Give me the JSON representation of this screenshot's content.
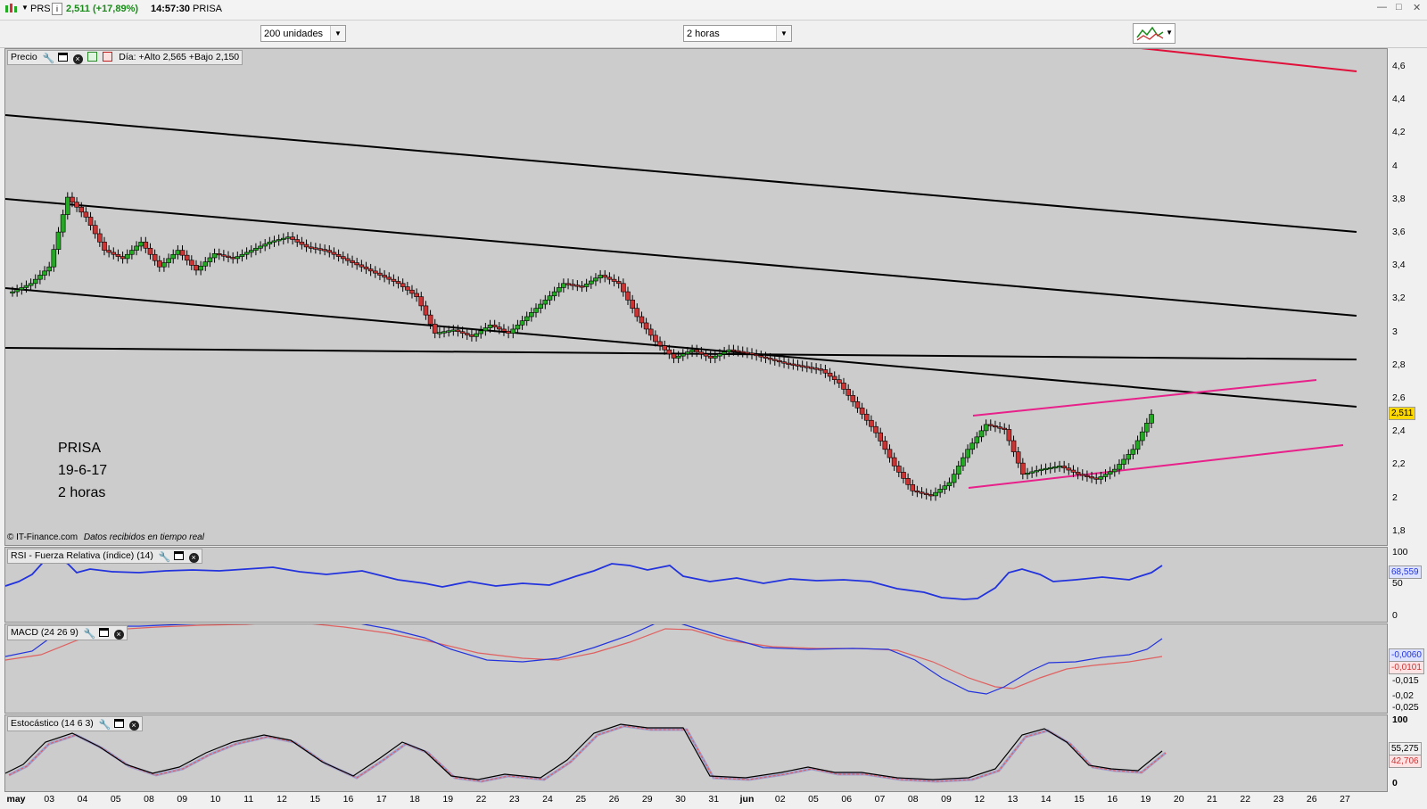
{
  "titlebar": {
    "symbol": "PRS",
    "info_icon": "i",
    "quote": "2,511 (+17,89%)",
    "time": "14:57:30",
    "name": "PRISA",
    "minimize": "—",
    "restore": "□",
    "close": "✕"
  },
  "toolbar": {
    "units_select": "200 unidades",
    "period_select": "2 horas"
  },
  "price_pane": {
    "header_label": "Precio",
    "day_info": "Día: +Alto 2,565 +Bajo 2,150",
    "note_lines": [
      "PRISA",
      "19-6-17",
      "2 horas"
    ],
    "source": "© IT-Finance.com",
    "source_note": "Datos recibidos en tiempo real",
    "y_ticks": [
      "4,6",
      "4,4",
      "4,2",
      "4",
      "3,8",
      "3,6",
      "3,4",
      "3,2",
      "3",
      "2,8",
      "2,6",
      "2,4",
      "2,2",
      "2",
      "1,8"
    ],
    "last_price_tag": "2,511",
    "colors": {
      "up": "#22aa22",
      "down": "#cc3333",
      "trend_black": "#000000",
      "trend_red": "#e0103a",
      "channel_pink": "#e8208a"
    }
  },
  "rsi_pane": {
    "header_label": "RSI - Fuerza Relativa (índice) (14)",
    "y_ticks": [
      "100",
      "50",
      "0"
    ],
    "value_tag": "68,559",
    "line_color": "#2233dd"
  },
  "macd_pane": {
    "header_label": "MACD (24 26 9)",
    "y_ticks": [
      "-0,015",
      "-0,02",
      "-0,025"
    ],
    "value_tags": [
      "-0,0060",
      "-0,0101"
    ]
  },
  "stoch_pane": {
    "header_label": "Estocástico (14 6 3)",
    "y_ticks": [
      "100",
      "0"
    ],
    "value_tags": [
      "55,275",
      "42,706"
    ]
  },
  "x_axis": {
    "labels": [
      "may",
      "03",
      "04",
      "05",
      "08",
      "09",
      "10",
      "11",
      "12",
      "15",
      "16",
      "17",
      "18",
      "19",
      "22",
      "23",
      "24",
      "25",
      "26",
      "29",
      "30",
      "31",
      "jun",
      "02",
      "05",
      "06",
      "07",
      "08",
      "09",
      "12",
      "13",
      "14",
      "15",
      "16",
      "19",
      "20",
      "21",
      "22",
      "23",
      "26",
      "27"
    ]
  },
  "chart_data": {
    "type": "candlestick",
    "title": "PRISA",
    "period": "2 horas",
    "x_categories": [
      "may",
      "03",
      "04",
      "05",
      "08",
      "09",
      "10",
      "11",
      "12",
      "15",
      "16",
      "17",
      "18",
      "19",
      "22",
      "23",
      "24",
      "25",
      "26",
      "29",
      "30",
      "31",
      "jun",
      "02",
      "05",
      "06",
      "07",
      "08",
      "09",
      "12",
      "13",
      "14",
      "15",
      "16",
      "19"
    ],
    "close_path": [
      3.25,
      3.3,
      3.4,
      3.82,
      3.7,
      3.5,
      3.45,
      3.55,
      3.4,
      3.5,
      3.38,
      3.48,
      3.45,
      3.5,
      3.55,
      3.58,
      3.52,
      3.5,
      3.45,
      3.4,
      3.35,
      3.3,
      3.22,
      3.0,
      3.02,
      2.98,
      3.05,
      3.0,
      3.1,
      3.2,
      3.3,
      3.28,
      3.35,
      3.3,
      3.1,
      2.95,
      2.85,
      2.9,
      2.85,
      2.9,
      2.88,
      2.85,
      2.82,
      2.8,
      2.78,
      2.7,
      2.55,
      2.4,
      2.2,
      2.05,
      2.02,
      2.1,
      2.3,
      2.45,
      2.42,
      2.15,
      2.18,
      2.2,
      2.15,
      2.12,
      2.18,
      2.3,
      2.511
    ],
    "rsi_last": 68.559,
    "macd_last": -0.006,
    "macd_signal_last": -0.0101,
    "stoch_k_last": 55.275,
    "stoch_d_last": 42.706
  }
}
